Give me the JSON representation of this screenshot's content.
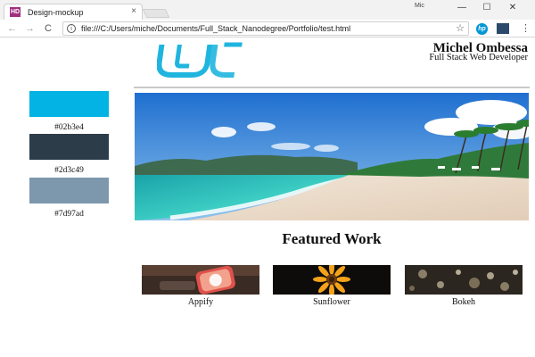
{
  "browser": {
    "tab_title": "Design-mockup",
    "tab_favicon": "HD",
    "tab_close": "×",
    "window_user": "Mic",
    "minimize": "—",
    "maximize": "☐",
    "close": "✕",
    "back": "←",
    "forward": "→",
    "reload": "C",
    "info": "i",
    "url": "file:///C:/Users/miche/Documents/Full_Stack_Nanodegree/Portfolio/test.html",
    "star": "☆",
    "hp_label": "hp",
    "menu": "⋮"
  },
  "header": {
    "name": "Michel Ombessa",
    "role": "Full Stack Web Developer",
    "logo_icon": "udacity-logo-icon"
  },
  "palette": [
    {
      "color": "#02b3e4",
      "label": "#02b3e4"
    },
    {
      "color": "#2d3c49",
      "label": "#2d3c49"
    },
    {
      "color": "#7d97ad",
      "label": "#7d97ad"
    }
  ],
  "hero": {
    "icon": "beach-image"
  },
  "featured": {
    "title": "Featured Work",
    "items": [
      {
        "label": "Appify",
        "icon": "appify-image"
      },
      {
        "label": "Sunflower",
        "icon": "sunflower-image"
      },
      {
        "label": "Bokeh",
        "icon": "bokeh-image"
      }
    ]
  }
}
